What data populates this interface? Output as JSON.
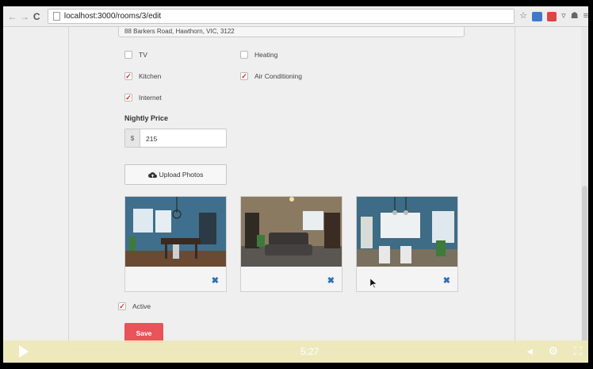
{
  "browser": {
    "url": "localhost:3000/rooms/3/edit",
    "back_icon": "arrow-left-icon",
    "forward_icon": "arrow-right-icon",
    "reload_icon": "reload-icon"
  },
  "form": {
    "address": "88 Barkers Road, Hawthorn, VIC, 3122",
    "amenities": [
      {
        "label": "TV",
        "checked": false
      },
      {
        "label": "Heating",
        "checked": false
      },
      {
        "label": "Kitchen",
        "checked": true
      },
      {
        "label": "Air Conditioning",
        "checked": true
      },
      {
        "label": "Internet",
        "checked": true
      }
    ],
    "price_label": "Nightly Price",
    "currency_symbol": "$",
    "price_value": "215",
    "upload_label": "Upload Photos",
    "active_label": "Active",
    "active_checked": true,
    "save_label": "Save",
    "check_mark": "✓"
  },
  "photos": [
    {
      "name": "dining-room-photo",
      "delete_icon": "✖"
    },
    {
      "name": "living-room-photo",
      "delete_icon": "✖"
    },
    {
      "name": "kitchen-photo",
      "delete_icon": "✖"
    }
  ],
  "player": {
    "time": "5:27"
  },
  "colors": {
    "save_button": "#e9535a",
    "delete_icon": "#2f6db5",
    "check": "#dd2222"
  }
}
